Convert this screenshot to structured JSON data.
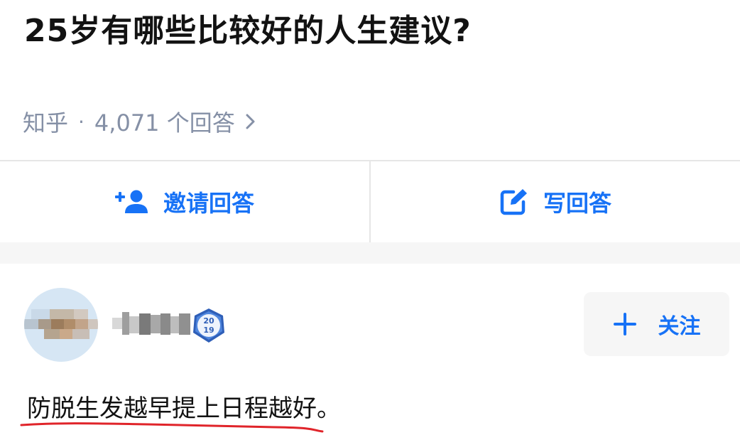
{
  "question": {
    "title": "25岁有哪些比较好的人生建议?"
  },
  "meta": {
    "source": "知乎",
    "separator": "·",
    "answer_count": "4,071 个回答",
    "chevron_icon": "chevron-right-icon"
  },
  "actions": {
    "invite_label": "邀请回答",
    "invite_icon": "add-user-icon",
    "write_label": "写回答",
    "write_icon": "edit-icon"
  },
  "answer": {
    "author_name": "",
    "badge_year_top": "20",
    "badge_year_bottom": "19",
    "follow_label": "关注",
    "follow_icon": "plus-icon",
    "content": "防脱生发越早提上日程越好。",
    "annotation_color": "#e0242a"
  },
  "colors": {
    "accent": "#1772f6",
    "muted": "#8590a6",
    "title": "#121212"
  }
}
